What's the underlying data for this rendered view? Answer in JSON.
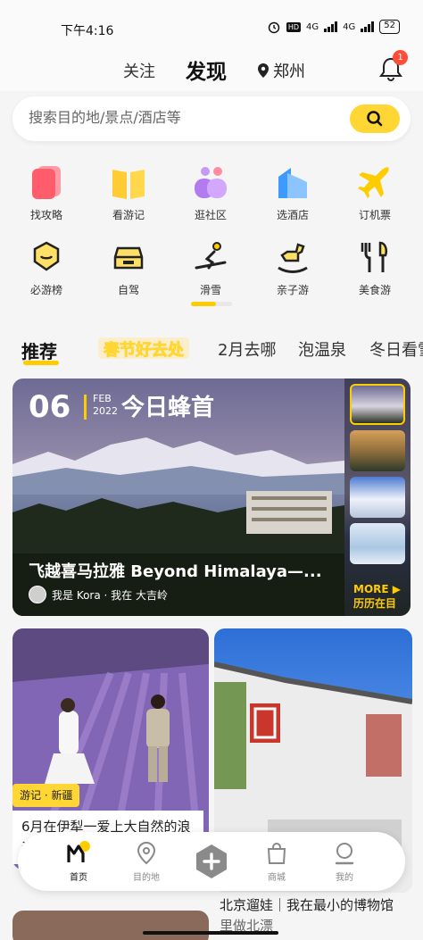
{
  "status_bar": {
    "time": "下午4:16",
    "network_1": "4G",
    "network_2": "4G",
    "battery": "52",
    "hd": "HD"
  },
  "header": {
    "tab_follow": "关注",
    "tab_discover": "发现",
    "location": "郑州",
    "notification_count": "1"
  },
  "search": {
    "placeholder": "搜索目的地/景点/酒店等"
  },
  "categories": [
    {
      "label": "找攻略",
      "icon": "guide-book-icon",
      "color": "#ff5c6c"
    },
    {
      "label": "看游记",
      "icon": "travelogue-icon",
      "color": "#ffcc33"
    },
    {
      "label": "逛社区",
      "icon": "community-icon",
      "color": "#b37bf0"
    },
    {
      "label": "选酒店",
      "icon": "hotel-icon",
      "color": "#3d9bff"
    },
    {
      "label": "订机票",
      "icon": "airplane-icon",
      "color": "#ffcc00"
    },
    {
      "label": "必游榜",
      "icon": "ranking-icon",
      "color": "#222222"
    },
    {
      "label": "自驾",
      "icon": "car-icon",
      "color": "#222222"
    },
    {
      "label": "滑雪",
      "icon": "ski-icon",
      "color": "#222222"
    },
    {
      "label": "亲子游",
      "icon": "rocking-horse-icon",
      "color": "#222222"
    },
    {
      "label": "美食游",
      "icon": "food-icon",
      "color": "#222222"
    }
  ],
  "tabs": [
    {
      "label": "推荐",
      "active": true
    },
    {
      "label": "春节好去处",
      "festival": true
    },
    {
      "label": "2月去哪"
    },
    {
      "label": "泡温泉"
    },
    {
      "label": "冬日看雪"
    }
  ],
  "banner": {
    "day": "06",
    "month": "FEB",
    "year": "2022",
    "daily_label": "今日蜂首",
    "title": "飞越喜马拉雅 Beyond Himalaya—...",
    "author": "我是 Kora · 我在 大吉岭",
    "more_label": "MORE",
    "more_sub": "历历在目"
  },
  "cards": [
    {
      "tag": "游记 · 新疆",
      "title": "6月在伊犁一爱上大自然的浪漫"
    },
    {
      "title": "北京遛娃｜我在最小的博物馆",
      "subtitle": "里做北漂"
    }
  ],
  "bottom_nav": [
    {
      "label": "首页",
      "icon": "home-icon",
      "active": true
    },
    {
      "label": "目的地",
      "icon": "location-pin-icon"
    },
    {
      "label": "",
      "icon": "add-icon"
    },
    {
      "label": "商城",
      "icon": "shopping-bag-icon"
    },
    {
      "label": "我的",
      "icon": "profile-icon"
    }
  ],
  "accent": "#ffcc00"
}
